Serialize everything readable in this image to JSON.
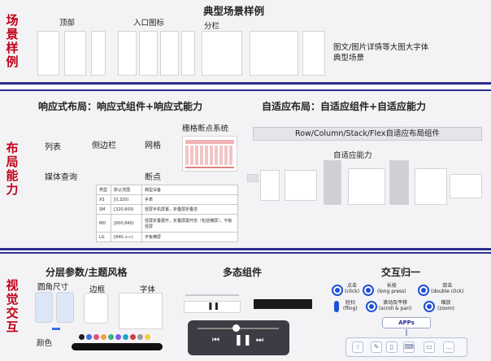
{
  "top": {
    "side_label": "场景样例",
    "title": "典型场景样例",
    "items": [
      "顶部",
      "入口图标",
      "分栏"
    ],
    "caption": "图文/图片详情等大图大字体典型场景"
  },
  "middle": {
    "side_label": "布局能力",
    "responsive_title": "响应式布局：响应式组件+响应式能力",
    "adaptive_title": "自适应布局：自适应组件+自适应能力",
    "grid_breakpoint": "栅格断点系统",
    "items": [
      "列表",
      "侧边栏",
      "网格",
      "媒体查询",
      "断点"
    ],
    "component_bar": "Row/Column/Stack/Flex自适应布局组件",
    "adaptive_ability": "自适应能力",
    "table": [
      [
        "类型",
        "默认范围",
        "典型设备"
      ],
      [
        "XS",
        "[0,320)",
        "手表"
      ],
      [
        "SM",
        "[320,600)",
        "竖屏手机屏幕，折叠屏折叠态"
      ],
      [
        "MD",
        "[600,840)",
        "竖屏折叠展开，折叠屏展开态（包括横屏）、平板竖屏"
      ],
      [
        "LG",
        "[840,+∞)",
        "平板横屏"
      ]
    ]
  },
  "bottom": {
    "side_label": "视觉交互",
    "layers_title": "分层参数/主题风格",
    "layers_items": [
      "圆角尺寸",
      "边框",
      "字体",
      "颜色"
    ],
    "multistate_title": "多态组件",
    "interaction_title": "交互归一",
    "gestures": [
      {
        "label": "点击",
        "en": "(click)"
      },
      {
        "label": "长按",
        "en": "(long press)"
      },
      {
        "label": "双击",
        "en": "(double click)"
      },
      {
        "label": "轻扫",
        "en": "(fling)"
      },
      {
        "label": "滚动及平移",
        "en": "(scroll & pan)"
      },
      {
        "label": "缩放",
        "en": "(zoom)"
      }
    ],
    "apps_label": "APPs",
    "palette": [
      "#1c1c1c",
      "#3a6fe0",
      "#e0507a",
      "#f2a23a",
      "#36b37e",
      "#7a5ce8",
      "#18a8c8",
      "#d23c3c",
      "#999999",
      "#f0d040"
    ]
  }
}
